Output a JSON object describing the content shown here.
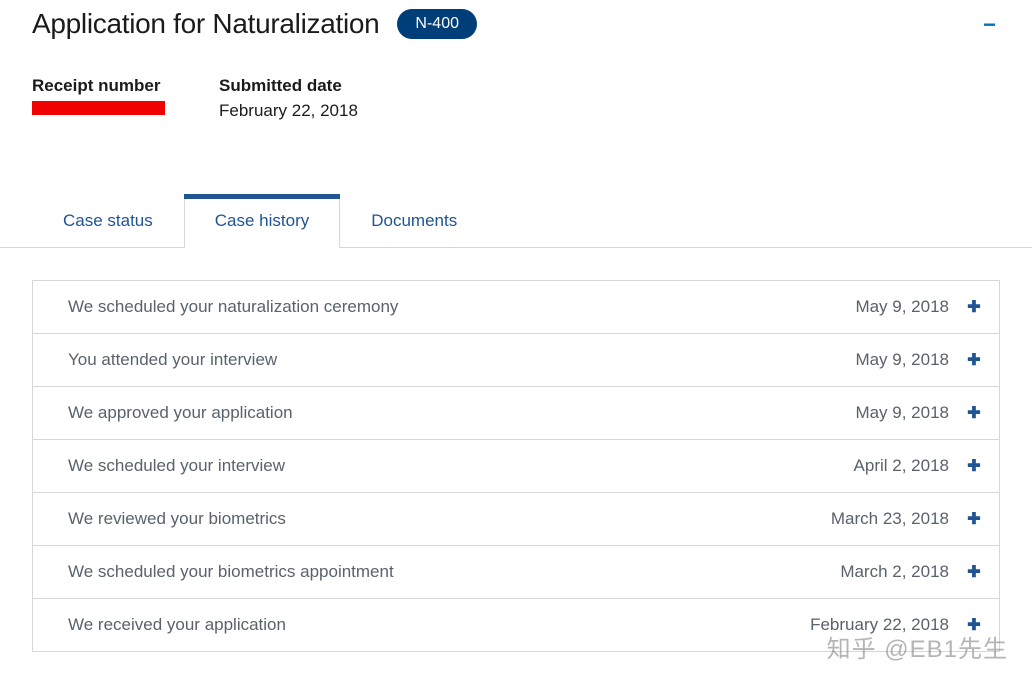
{
  "header": {
    "title": "Application for Naturalization",
    "form_code": "N-400",
    "collapse_symbol": "−"
  },
  "meta": {
    "receipt_label": "Receipt number",
    "submitted_label": "Submitted date",
    "submitted_date": "February 22, 2018"
  },
  "tabs": {
    "status": "Case status",
    "history": "Case history",
    "documents": "Documents"
  },
  "history": [
    {
      "title": "We scheduled your naturalization ceremony",
      "date": "May 9, 2018"
    },
    {
      "title": "You attended your interview",
      "date": "May 9, 2018"
    },
    {
      "title": "We approved your application",
      "date": "May 9, 2018"
    },
    {
      "title": "We scheduled your interview",
      "date": "April 2, 2018"
    },
    {
      "title": "We reviewed your biometrics",
      "date": "March 23, 2018"
    },
    {
      "title": "We scheduled your biometrics appointment",
      "date": "March 2, 2018"
    },
    {
      "title": "We received your application",
      "date": "February 22, 2018"
    }
  ],
  "expand_symbol": "✚",
  "watermark": "知乎 @EB1先生"
}
